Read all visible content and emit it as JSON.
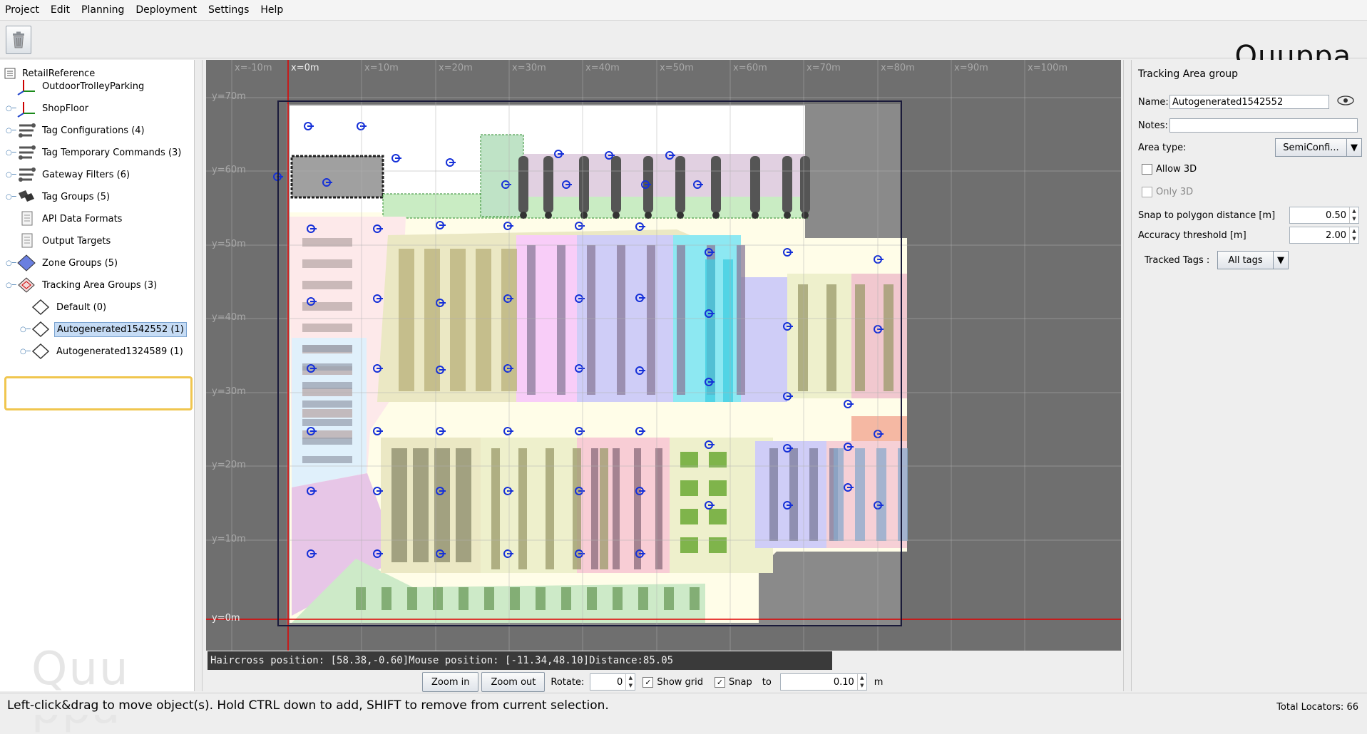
{
  "menu": [
    "Project",
    "Edit",
    "Planning",
    "Deployment",
    "Settings",
    "Help"
  ],
  "logo": "Quuppa",
  "tree": {
    "root": "RetailReference",
    "items": [
      {
        "label": "OutdoorTrolleyParking",
        "icon": "axes-icon",
        "level": 1
      },
      {
        "label": "ShopFloor",
        "icon": "axes-icon",
        "level": 1
      },
      {
        "label": "Tag Configurations (4)",
        "icon": "wrench-icon",
        "level": 1
      },
      {
        "label": "Tag Temporary Commands (3)",
        "icon": "wrench-icon",
        "level": 1
      },
      {
        "label": "Gateway Filters (6)",
        "icon": "wrench-icon",
        "level": 1
      },
      {
        "label": "Tag Groups (5)",
        "icon": "tags-icon",
        "level": 1
      },
      {
        "label": "API Data Formats",
        "icon": "document-icon",
        "level": 1
      },
      {
        "label": "Output Targets",
        "icon": "document-icon",
        "level": 1
      },
      {
        "label": "Zone Groups (5)",
        "icon": "zone-icon",
        "level": 1
      },
      {
        "label": "Tracking Area Groups (3)",
        "icon": "area-icon",
        "level": 1
      },
      {
        "label": "Default (0)",
        "icon": "diamond-icon",
        "level": 2
      },
      {
        "label": "Autogenerated1542552 (1)",
        "icon": "diamond-icon",
        "level": 2
      },
      {
        "label": "Autogenerated1324589 (1)",
        "icon": "diamond-icon",
        "level": 2
      }
    ]
  },
  "canvas": {
    "x_labels": [
      "x=-10m",
      "x=0m",
      "x=10m",
      "x=20m",
      "x=30m",
      "x=40m",
      "x=50m",
      "x=60m",
      "x=70m",
      "x=80m",
      "x=90m",
      "x=100m"
    ],
    "y_labels": [
      "y=70m",
      "y=60m",
      "y=50m",
      "y=40m",
      "y=30m",
      "y=20m",
      "y=10m",
      "y=0m"
    ],
    "haircross_label": "Haircross position: [",
    "haircross_x": "58.38,",
    "haircross_y": "-0.60]",
    "mouse_label": "Mouse position: [",
    "mouse_x": "-11.34,",
    "mouse_y": "48.10]",
    "distance_label": "Distance:",
    "distance_value": "85.05"
  },
  "zoom": {
    "zoom_in": "Zoom in",
    "zoom_out": "Zoom out",
    "rotate_label": "Rotate:",
    "rotate_value": "0",
    "show_grid_label": "Show grid",
    "show_grid_checked": "✓",
    "snap_label": "Snap",
    "snap_checked": "✓",
    "to_label": "to",
    "snap_value": "0.10",
    "unit": "m"
  },
  "props": {
    "title": "Tracking Area group",
    "name_label": "Name:",
    "name_value": "Autogenerated1542552",
    "notes_label": "Notes:",
    "notes_value": "",
    "area_type_label": "Area type:",
    "area_type_value": "SemiConfi...",
    "allow3d_label": "Allow 3D",
    "only3d_label": "Only 3D",
    "snap_polygon_label": "Snap to polygon distance [m]",
    "snap_polygon_value": "0.50",
    "accuracy_label": "Accuracy threshold [m]",
    "accuracy_value": "2.00",
    "tracked_tags_label": "Tracked Tags :",
    "tracked_tags_value": "All tags"
  },
  "status": {
    "message": "Left-click&drag to move object(s). Hold CTRL down to add, SHIFT to remove from current selection.",
    "locators": "Total Locators: 66"
  }
}
